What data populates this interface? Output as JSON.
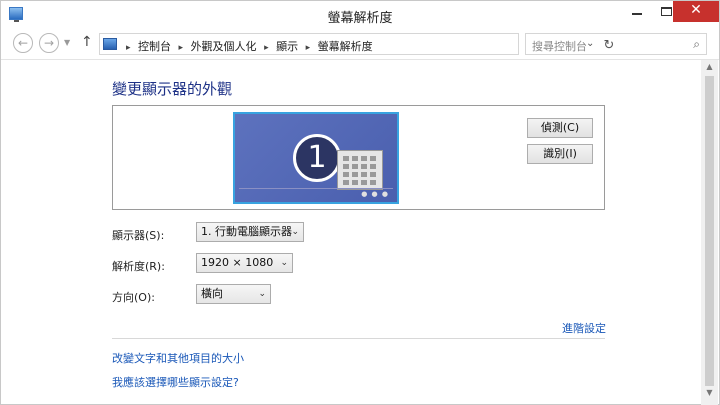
{
  "window": {
    "title": "螢幕解析度"
  },
  "nav": {
    "breadcrumbs": [
      "控制台",
      "外觀及個人化",
      "顯示",
      "螢幕解析度"
    ],
    "search_placeholder": "搜尋控制台"
  },
  "content": {
    "heading": "變更顯示器的外觀",
    "monitor_number": "1",
    "detect_button": "偵測(C)",
    "identify_button": "識別(I)",
    "display_label": "顯示器(S):",
    "display_value": "1. 行動電腦顯示器",
    "resolution_label": "解析度(R):",
    "resolution_value": "1920 × 1080",
    "orientation_label": "方向(O):",
    "orientation_value": "橫向",
    "advanced_link": "進階設定",
    "text_size_link": "改變文字和其他項目的大小",
    "which_settings_link": "我應該選擇哪些顯示設定?"
  },
  "icons": {
    "app": "display-control-panel-icon",
    "back": "back-arrow-icon",
    "forward": "forward-arrow-icon",
    "up": "up-arrow-icon",
    "refresh": "refresh-icon",
    "search": "search-icon"
  }
}
